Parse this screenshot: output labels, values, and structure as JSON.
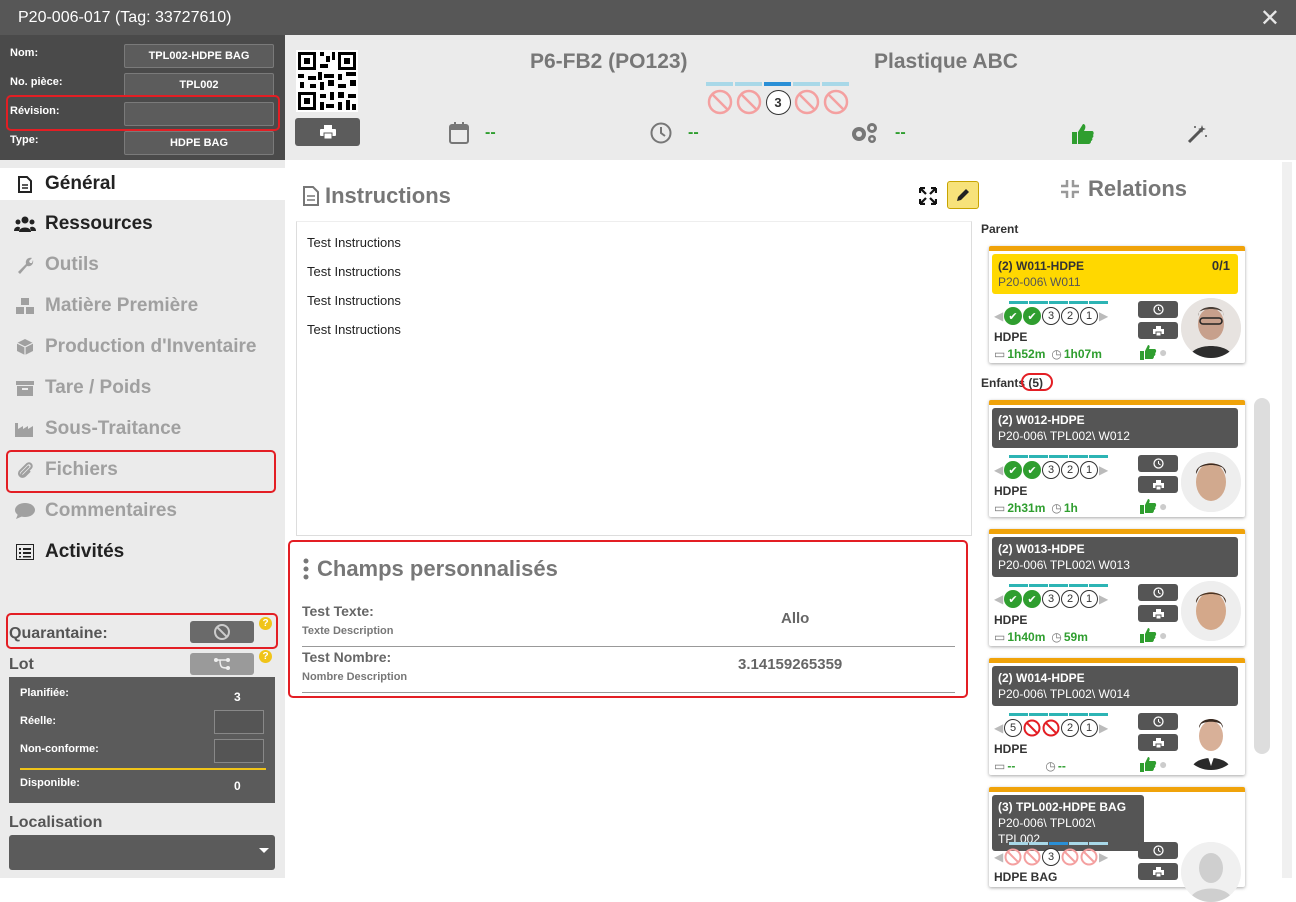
{
  "window": {
    "title": "P20-006-017 (Tag: 33727610)",
    "close_icon": "close-icon"
  },
  "info": {
    "fields": [
      {
        "label": "Nom:",
        "value": "TPL002-HDPE BAG"
      },
      {
        "label": "No. pièce:",
        "value": "TPL002"
      },
      {
        "label": "Révision:",
        "value": ""
      },
      {
        "label": "Type:",
        "value": "HDPE BAG"
      }
    ]
  },
  "header": {
    "operation": "P6-FB2 (PO123)",
    "client": "Plastique ABC",
    "current_step": "3",
    "date_value": "--",
    "time_value": "--",
    "settings_value": "--"
  },
  "nav": {
    "items": [
      {
        "label": "Général",
        "icon": "file-icon"
      },
      {
        "label": "Ressources",
        "icon": "users-icon"
      },
      {
        "label": "Outils",
        "icon": "wrench-icon"
      },
      {
        "label": "Matière Première",
        "icon": "cubes-icon"
      },
      {
        "label": "Production d'Inventaire",
        "icon": "box-icon"
      },
      {
        "label": "Tare / Poids",
        "icon": "archive-icon"
      },
      {
        "label": "Sous-Traitance",
        "icon": "factory-icon"
      },
      {
        "label": "Fichiers",
        "icon": "paperclip-icon"
      },
      {
        "label": "Commentaires",
        "icon": "comment-icon"
      },
      {
        "label": "Activités",
        "icon": "list-icon"
      }
    ],
    "quarantine_label": "Quarantaine:",
    "lot_label": "Lot",
    "quantities": {
      "planned_label": "Planifiée:",
      "planned_value": "3",
      "real_label": "Réelle:",
      "nonconform_label": "Non-conforme:",
      "available_label": "Disponible:",
      "available_value": "0"
    },
    "location_label": "Localisation"
  },
  "instructions": {
    "title": "Instructions",
    "lines": [
      "Test Instructions",
      "Test Instructions",
      "Test Instructions",
      "Test Instructions"
    ]
  },
  "custom_fields": {
    "title": "Champs personnalisés",
    "rows": [
      {
        "title": "Test Texte:",
        "description": "Texte Description",
        "value": "Allo"
      },
      {
        "title": "Test Nombre:",
        "description": "Nombre Description",
        "value": "3.14159265359"
      }
    ]
  },
  "relations": {
    "title": "Relations",
    "parent_label": "Parent",
    "children_label": "Enfants",
    "children_count": "(5)",
    "parent": {
      "name": "(2) W011-HDPE",
      "path": "P20-006\\ W011",
      "counter": "0/1",
      "resource": "HDPE",
      "time_a": "1h52m",
      "time_b": "1h07m"
    },
    "children": [
      {
        "name": "(2) W012-HDPE",
        "path": "P20-006\\ TPL002\\ W012",
        "resource": "HDPE",
        "time_a": "2h31m",
        "time_b": "1h"
      },
      {
        "name": "(2) W013-HDPE",
        "path": "P20-006\\ TPL002\\ W013",
        "resource": "HDPE",
        "time_a": "1h40m",
        "time_b": "59m"
      },
      {
        "name": "(2) W014-HDPE",
        "path": "P20-006\\ TPL002\\ W014",
        "resource": "HDPE",
        "time_a": "--",
        "time_b": "--"
      },
      {
        "name": "(3) TPL002-HDPE BAG",
        "path": "P20-006\\ TPL002\\ TPL002",
        "resource": "HDPE BAG"
      }
    ],
    "step_numbers": {
      "a": "3",
      "b": "2",
      "c": "1",
      "d": "5"
    }
  },
  "colors": {
    "accent_green": "#2f9e2f",
    "accent_orange": "#f0a30a",
    "highlight_red": "#e31e24",
    "parent_yellow": "#ffd800"
  }
}
